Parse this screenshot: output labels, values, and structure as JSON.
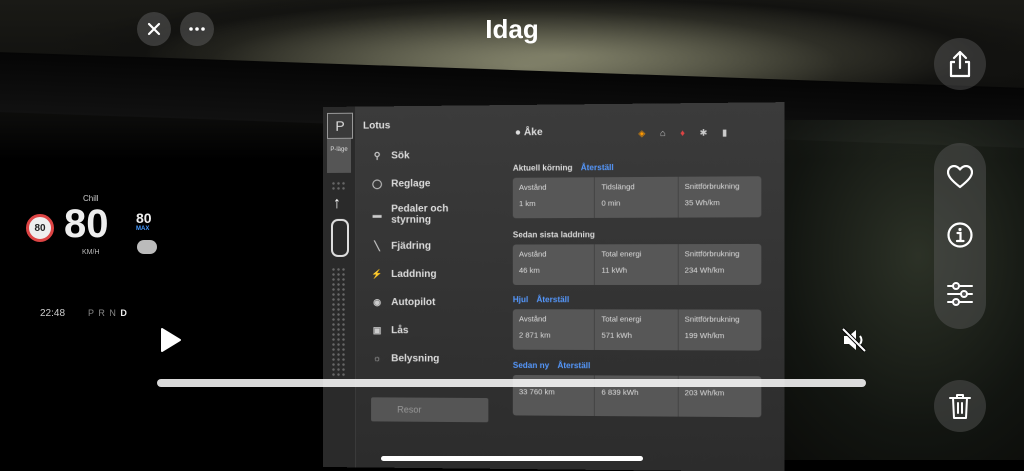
{
  "header": {
    "title": "Idag",
    "close_icon": "close-icon",
    "more_icon": "more-icon"
  },
  "side": {
    "share_icon": "share-icon",
    "favorite_icon": "heart-icon",
    "info_icon": "info-icon",
    "adjust_icon": "sliders-icon",
    "delete_icon": "trash-icon"
  },
  "player": {
    "play_icon": "play-icon",
    "mute_icon": "speaker-muted-icon",
    "progress": 0.0
  },
  "cluster": {
    "mode": "Chill",
    "speed": "80",
    "unit": "KM/H",
    "sign": "80",
    "limit": "80",
    "limit_label": "MAX",
    "time": "22:48",
    "gears": "P R N",
    "active_gear": "D"
  },
  "screen": {
    "park": "P",
    "park_label": "P-läge",
    "menu_title": "Lotus",
    "menu": [
      {
        "label": "Sök",
        "icon": "search-icon"
      },
      {
        "label": "Reglage",
        "icon": "toggle-icon"
      },
      {
        "label": "Pedaler och styrning",
        "icon": "car-icon"
      },
      {
        "label": "Fjädring",
        "icon": "suspension-icon"
      },
      {
        "label": "Laddning",
        "icon": "bolt-icon"
      },
      {
        "label": "Autopilot",
        "icon": "steering-icon"
      },
      {
        "label": "Lås",
        "icon": "lock-icon"
      },
      {
        "label": "Belysning",
        "icon": "sun-icon"
      }
    ],
    "menu_button": "Resor",
    "user": "Åke",
    "status_icons": [
      "sentry-icon",
      "home-icon",
      "bell-icon",
      "bluetooth-icon",
      "lte-signal-icon"
    ],
    "sections": [
      {
        "title": "Aktuell körning",
        "reset": "Återställ",
        "cells": [
          {
            "label": "Avstånd",
            "value": "1 km"
          },
          {
            "label": "Tidslängd",
            "value": "0 min"
          },
          {
            "label": "Snittförbrukning",
            "value": "35 Wh/km"
          }
        ]
      },
      {
        "title": "Sedan sista laddning",
        "reset": "",
        "cells": [
          {
            "label": "Avstånd",
            "value": "46 km"
          },
          {
            "label": "Total energi",
            "value": "11 kWh"
          },
          {
            "label": "Snittförbrukning",
            "value": "234 Wh/km"
          }
        ]
      },
      {
        "title": "Hjul",
        "reset": "Återställ",
        "cells": [
          {
            "label": "Avstånd",
            "value": "2 871 km"
          },
          {
            "label": "Total energi",
            "value": "571 kWh"
          },
          {
            "label": "Snittförbrukning",
            "value": "199 Wh/km"
          }
        ]
      },
      {
        "title": "Sedan ny",
        "reset": "Återställ",
        "cells": [
          {
            "label": "",
            "value": "33 760 km"
          },
          {
            "label": "",
            "value": "6 839 kWh"
          },
          {
            "label": "",
            "value": "203 Wh/km"
          }
        ]
      }
    ]
  }
}
